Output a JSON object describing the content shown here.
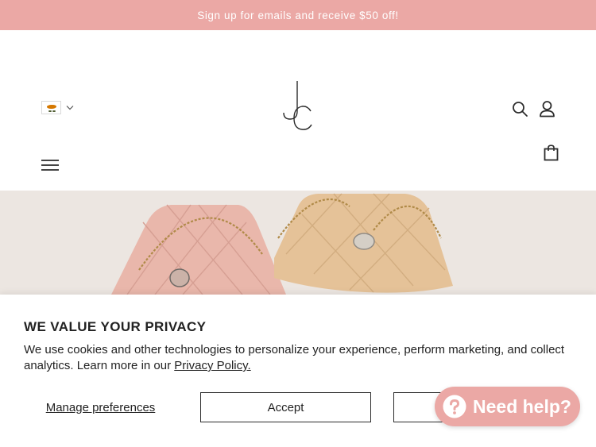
{
  "announcement": {
    "text": "Sign up for emails and receive $50 off!"
  },
  "header": {
    "flag_label": "Cyprus",
    "logo_text": "JC",
    "icons": [
      "flag-icon",
      "chevron-down-icon",
      "search-icon",
      "account-icon",
      "shopping-bag-icon",
      "menu-icon"
    ]
  },
  "privacy": {
    "title": "WE VALUE YOUR PRIVACY",
    "description": "We use cookies and other technologies to personalize your experience, perform marketing, and collect analytics. Learn more in our ",
    "policy_link": "Privacy Policy.",
    "manage_label": "Manage preferences",
    "accept_label": "Accept"
  },
  "help_chat": {
    "label": "Need help?"
  },
  "colors": {
    "accent": "#eba8a5",
    "text": "#222222",
    "hero_bg": "#e9e2dd"
  }
}
